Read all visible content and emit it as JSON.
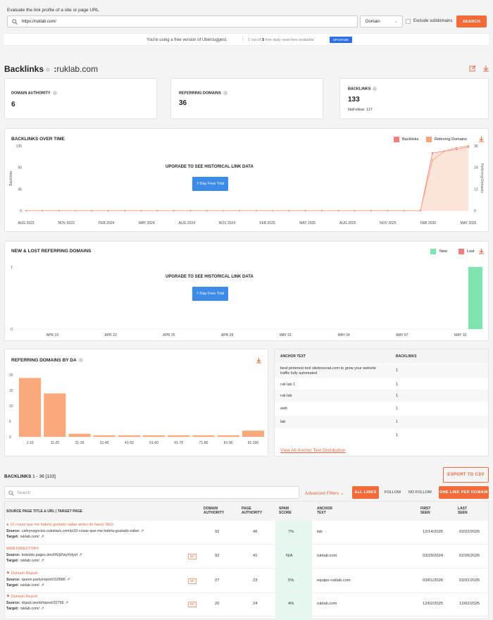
{
  "search": {
    "label": "Evaluate the link profile of a site or page URL",
    "value": "https://ruklab.com/",
    "domain_select": "Domain",
    "exclude_label": "Exclude subdomains",
    "button": "SEARCH"
  },
  "banner": {
    "text": "You're using a free version of Ubersuggest.",
    "count_prefix": "1 out of",
    "count_bold": "3",
    "count_suffix": "free daily searches available",
    "button": "UPGRADE"
  },
  "header": {
    "title": "Backlinks",
    "separator": ":",
    "domain": "ruklab.com"
  },
  "stats": {
    "da_label": "DOMAIN AUTHORITY",
    "da_value": "6",
    "rd_label": "REFERRING DOMAINS",
    "rd_value": "36",
    "bl_label": "BACKLINKS",
    "bl_value": "133",
    "bl_sub": "NoFollow: 117"
  },
  "over_time": {
    "title": "BACKLINKS OVER TIME",
    "legend": [
      "Backlinks",
      "Referring Domains"
    ],
    "upgrade": "UPGRADE TO SEE HISTORICAL LINK DATA",
    "trial": "7-Day Free Trial",
    "ylabel_left": "Backlinks",
    "ylabel_right": "Referring Domains",
    "y_left": [
      "135",
      "90",
      "45",
      "0"
    ],
    "y_right": [
      "36",
      "24",
      "12",
      "0"
    ],
    "x": [
      "AUG 2023",
      "NOV 2023",
      "FEB 2024",
      "MAY 2024",
      "AUG 2024",
      "NOV 2024",
      "FEB 2025",
      "MAY 2025",
      "AUG 2025",
      "NOV 2025",
      "FEB 2026",
      "MAY 2026"
    ]
  },
  "new_lost": {
    "title": "NEW & LOST REFERRING DOMAINS",
    "legend": [
      "New",
      "Lost"
    ],
    "upgrade": "UPGRADE TO SEE HISTORICAL LINK DATA",
    "trial": "7-Day Free Trial",
    "y": [
      "1",
      "0"
    ],
    "x": [
      "APR 19",
      "APR 22",
      "APR 25",
      "APR 28",
      "MAY 01",
      "MAY 04",
      "MAY 07",
      "MAY 10"
    ]
  },
  "by_da": {
    "title": "REFERRING DOMAINS BY DA"
  },
  "anchor": {
    "col1": "ANCHOR TEXT",
    "col2": "BACKLINKS",
    "rows": [
      {
        "text": "best pinterest tool sitetosocial.com to grow your website traffic fully automated",
        "count": "1"
      },
      {
        "text": "ruk lab 1",
        "count": "1"
      },
      {
        "text": "ruk lab",
        "count": "1"
      },
      {
        "text": "web",
        "count": "1"
      },
      {
        "text": "lab",
        "count": "1"
      },
      {
        "text": "",
        "count": "1"
      }
    ],
    "link": "View All Anchor Text Distribution"
  },
  "backlinks": {
    "title": "BACKLINKS",
    "range": "1 - 36 [133]",
    "export": "EXPORT TO CSV",
    "search_placeholder": "Search",
    "adv_filters": "Advanced Filters",
    "tabs": [
      "ALL LINKS",
      "FOLLOW",
      "NO FOLLOW"
    ],
    "one_link": "ONE LINK PER DOMAIN",
    "cols": {
      "source": "SOURCE PAGE TITLE & URL | TARGET PAGE",
      "da": "DOMAIN AUTHORITY",
      "pa": "PAGE AUTHORITY",
      "spam": "SPAM SCORE",
      "anchor": "ANCHOR TEXT",
      "first": "FIRST SEEN",
      "last": "LAST SEEN"
    },
    "source_label": "Source:",
    "target_label": "Target:",
    "nf": "NF",
    "rows": [
      {
        "title": "10 cosas que me habría gustado saber antes de hacer SEO",
        "source": "cafeynegocios.substack.com/p/10-cosas-que-me-habria-gustado-saber",
        "target": "ruklab.com/",
        "nf": false,
        "da": "92",
        "pa": "46",
        "spam": "7%",
        "anchor": "lab",
        "first": "12/14/2025",
        "last": "03/22/2026"
      },
      {
        "title": "WEB DIRECTORY",
        "source": "kobolds.pages.dev/06/jiZwyXHyst",
        "target": "ruklab.com/",
        "nf": true,
        "da": "92",
        "pa": "41",
        "spam": "N/A",
        "anchor": "ruklab.com",
        "first": "03/29/2024",
        "last": "02/26/2026"
      },
      {
        "title": "Domain Report",
        "source": "queen.party/report/110586",
        "target": "ruklab.com/",
        "nf": true,
        "da": "27",
        "pa": "23",
        "spam": "5%",
        "anchor": "equipo-ruklab.com",
        "first": "03/01/2026",
        "last": "03/31/2026"
      },
      {
        "title": "Domain Report",
        "source": "drjack.world/report/32756",
        "target": "ruklab.com/",
        "nf": true,
        "da": "20",
        "pa": "24",
        "spam": "4%",
        "anchor": "ruklab.com",
        "first": "12/02/2025",
        "last": "12/02/2025"
      }
    ]
  },
  "colors": {
    "accent": "#f26b38",
    "backlinks": "#f27d7d",
    "referring": "#f7a57c",
    "new": "#7ee5b0",
    "lost": "#f27d7d",
    "bar": "#f9a97c"
  },
  "chart_data": [
    {
      "type": "line",
      "title": "BACKLINKS OVER TIME",
      "x": [
        "AUG 2023",
        "NOV 2023",
        "FEB 2024",
        "MAY 2024",
        "AUG 2024",
        "NOV 2024",
        "FEB 2025",
        "MAY 2025",
        "AUG 2025",
        "NOV 2025",
        "JAN 2026",
        "FEB 2026",
        "MAR 2026",
        "APR 2026",
        "MAY 2026"
      ],
      "series": [
        {
          "name": "Backlinks",
          "values": [
            0,
            0,
            0,
            0,
            0,
            0,
            0,
            0,
            0,
            0,
            0,
            120,
            124,
            128,
            133
          ]
        },
        {
          "name": "Referring Domains",
          "values": [
            0,
            0,
            0,
            0,
            0,
            0,
            0,
            0,
            0,
            0,
            0,
            28,
            33,
            35,
            36
          ]
        }
      ],
      "ylim": [
        0,
        135
      ],
      "y2lim": [
        0,
        36
      ]
    },
    {
      "type": "bar",
      "title": "NEW & LOST REFERRING DOMAINS",
      "categories": [
        "APR 19",
        "APR 22",
        "APR 25",
        "APR 28",
        "MAY 01",
        "MAY 04",
        "MAY 07",
        "MAY 10"
      ],
      "series": [
        {
          "name": "New",
          "values": [
            0,
            0,
            0,
            0,
            0,
            0,
            0,
            1
          ]
        },
        {
          "name": "Lost",
          "values": [
            0,
            0,
            0,
            0,
            0,
            0,
            0,
            0
          ]
        }
      ],
      "ylim": [
        0,
        1
      ]
    },
    {
      "type": "bar",
      "title": "REFERRING DOMAINS BY DA",
      "categories": [
        "1-10",
        "11-20",
        "21-30",
        "31-40",
        "41-50",
        "51-60",
        "61-70",
        "71-80",
        "81-90",
        "91-100"
      ],
      "values": [
        19,
        14,
        1,
        0.5,
        0.5,
        0.5,
        0.5,
        0.5,
        0.5,
        2
      ],
      "y_ticks": [
        "20",
        "15",
        "10",
        "5",
        "0"
      ],
      "ylim": [
        0,
        20
      ]
    }
  ]
}
